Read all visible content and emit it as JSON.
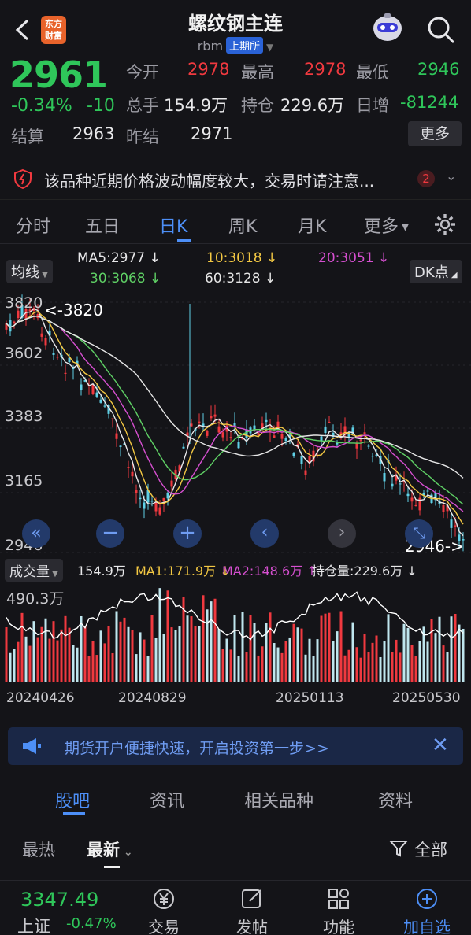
{
  "header": {
    "title": "螺纹钢主连",
    "code": "rbm",
    "exchange": "上期所",
    "logo_text_1": "东方",
    "logo_text_2": "财富"
  },
  "quote": {
    "price": "2961",
    "change_pct": "-0.34%",
    "change": "-10",
    "open_label": "今开",
    "open": "2978",
    "high_label": "最高",
    "high": "2978",
    "low_label": "最低",
    "low": "2946",
    "volume_label": "总手",
    "volume": "154.9万",
    "oi_label": "持仓",
    "oi": "229.6万",
    "daily_inc_label": "日增",
    "daily_inc": "-81244",
    "settle_label": "结算",
    "settle": "2963",
    "prev_settle_label": "昨结",
    "prev_settle": "2971",
    "more": "更多"
  },
  "notice": {
    "text": "该品种近期价格波动幅度较大，交易时请注意...",
    "count": "2"
  },
  "period_tabs": [
    "分时",
    "五日",
    "日K",
    "周K",
    "月K",
    "更多"
  ],
  "active_period": "日K",
  "ma_panel": {
    "selector": "均线",
    "ma5": "MA5:2977",
    "ma10": "10:3018",
    "ma20": "20:3051",
    "ma30": "30:3068",
    "ma60": "60:3128",
    "dk": "DK点"
  },
  "price_axis": [
    "3820",
    "3602",
    "3383",
    "3165",
    "2946"
  ],
  "annotations": {
    "high_mark": "<-3820",
    "low_mark": "2946->"
  },
  "volume_panel": {
    "selector": "成交量",
    "vol": "154.9万",
    "ma1": "MA1:171.9万",
    "ma2": "MA2:148.6万",
    "oi": "持仓量:229.6万",
    "max": "490.3万"
  },
  "dates": [
    "20240426",
    "20240829",
    "20250113",
    "20250530"
  ],
  "colors": {
    "up": "#f0393f",
    "down": "#2fc65a",
    "accent": "#4d8ff7",
    "ma5": "#e8e8ea",
    "ma10": "#f3c843",
    "ma20": "#d64fd0",
    "ma30": "#5fd065",
    "ma60": "#e6e6e6"
  },
  "banner": {
    "text": "期货开户便捷快速，开启投资第一步>>"
  },
  "bottom_tabs": [
    "股吧",
    "资讯",
    "相关品种",
    "资料"
  ],
  "active_bottom_tab": "股吧",
  "filters": {
    "hot": "最热",
    "latest": "最新",
    "all": "全部"
  },
  "footer": {
    "index_value": "3347.49",
    "index_name": "上证",
    "index_change": "-0.47%",
    "trade": "交易",
    "post": "发帖",
    "func": "功能",
    "add": "加自选"
  }
}
